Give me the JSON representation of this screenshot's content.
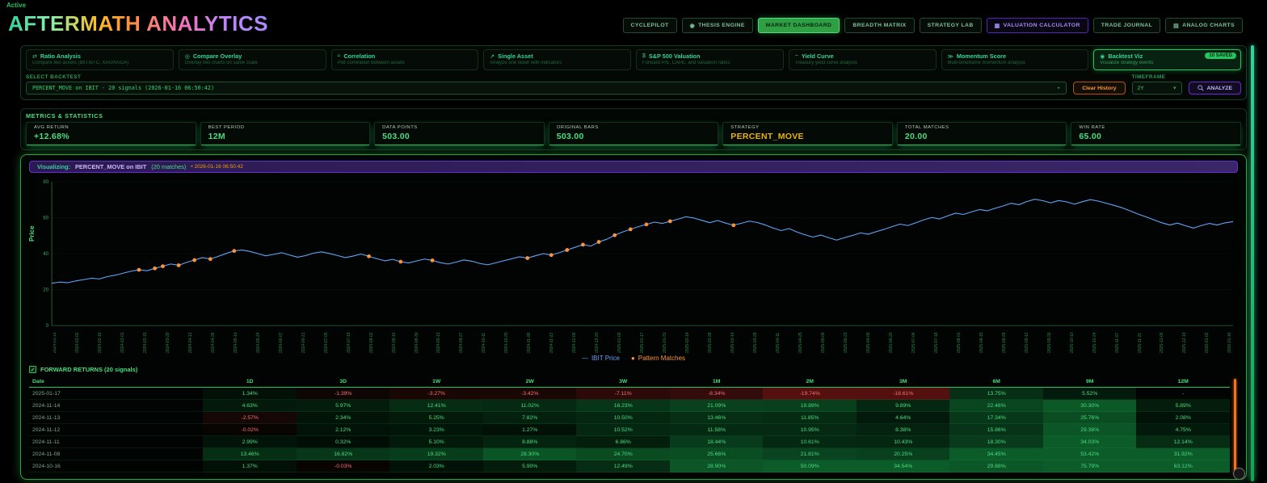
{
  "app": {
    "status": "Active",
    "title": "AFTERMATH ANALYTICS"
  },
  "nav": {
    "items": [
      {
        "label": "CYCLEPILOT"
      },
      {
        "label": "THESIS ENGINE",
        "icon": "◉",
        "icon_name": "thesis-engine-icon"
      },
      {
        "label": "MARKET DASHBOARD",
        "active": true
      },
      {
        "label": "BREADTH MATRIX"
      },
      {
        "label": "STRATEGY LAB"
      },
      {
        "label": "VALUATION CALCULATOR",
        "icon": "▦",
        "icon_name": "calculator-icon",
        "variant": "purple"
      },
      {
        "label": "TRADE JOURNAL"
      },
      {
        "label": "ANALOG CHARTS",
        "icon": "▤",
        "icon_name": "analog-charts-icon"
      }
    ]
  },
  "tools": {
    "cards": [
      {
        "icon": "⇄",
        "icon_name": "ratio-icon",
        "title": "Ratio Analysis",
        "subtitle": "Compare two assets (IBIT/BTC, XAU/NVDA)"
      },
      {
        "icon": "◎",
        "icon_name": "overlay-icon",
        "title": "Compare Overlay",
        "subtitle": "Overlay two charts on same scale"
      },
      {
        "icon": "≈",
        "icon_name": "correlation-icon",
        "title": "Correlation",
        "subtitle": "Plot correlation between assets"
      },
      {
        "icon": "↗",
        "icon_name": "trend-icon",
        "title": "Single Asset",
        "subtitle": "Analyze one ticker with indicators"
      },
      {
        "icon": "$",
        "icon_name": "dollar-icon",
        "title": "S&P 500 Valuation",
        "subtitle": "Forward P/E, CAPE, and valuation ratios"
      },
      {
        "icon": "~",
        "icon_name": "yield-curve-icon",
        "title": "Yield Curve",
        "subtitle": "Treasury yield curve analysis"
      },
      {
        "icon": "≫",
        "icon_name": "momentum-icon",
        "title": "Momentum Score",
        "subtitle": "Multi-timeframe momentum analysis"
      },
      {
        "icon": "◉",
        "icon_name": "backtest-icon",
        "title": "Backtest Viz",
        "subtitle": "Visualize strategy events",
        "selected": true,
        "badge": "10 SAVED"
      }
    ]
  },
  "backtest": {
    "label": "SELECT BACKTEST",
    "value": "PERCENT_MOVE on IBIT - 20 signals (2026-01-16 06:50:42)",
    "clear_label": "Clear History",
    "timeframe_label": "TIMEFRAME",
    "timeframe_value": "2Y",
    "analyze_label": "ANALYZE"
  },
  "metrics": {
    "heading": "METRICS & STATISTICS",
    "cards": [
      {
        "label": "AVG RETURN",
        "value": "+12.68%",
        "color": "#4ade80"
      },
      {
        "label": "BEST PERIOD",
        "value": "12M",
        "color": "#4ade80"
      },
      {
        "label": "DATA POINTS",
        "value": "503.00",
        "color": "#4ade80"
      },
      {
        "label": "ORIGINAL BARS",
        "value": "503.00",
        "color": "#4ade80"
      },
      {
        "label": "STRATEGY",
        "value": "PERCENT_MOVE",
        "color": "#eab308"
      },
      {
        "label": "TOTAL MATCHES",
        "value": "20.00",
        "color": "#4ade80"
      },
      {
        "label": "WIN RATE",
        "value": "65.00",
        "color": "#4ade80"
      }
    ]
  },
  "viz": {
    "prefix": "Visualizing:",
    "name": "PERCENT_MOVE on IBIT",
    "matches": "(20 matches)",
    "timestamp": "• 2026-01-16 06:50:42"
  },
  "chart_data": {
    "type": "line",
    "title": "",
    "xlabel": "",
    "ylabel": "Price",
    "ylim": [
      0,
      80
    ],
    "yticks": [
      0,
      20,
      40,
      60,
      80
    ],
    "grid": true,
    "legend_position": "bottom",
    "legend": [
      "IBIT Price",
      "Pattern Matches"
    ],
    "x_labels": [
      "2024-01-19",
      "2024-02-02",
      "2024-02-16",
      "2024-03-01",
      "2024-03-15",
      "2024-03-29",
      "2024-04-12",
      "2024-04-26",
      "2024-05-10",
      "2024-05-24",
      "2024-06-07",
      "2024-06-21",
      "2024-07-05",
      "2024-07-19",
      "2024-08-02",
      "2024-08-16",
      "2024-08-30",
      "2024-09-13",
      "2024-09-27",
      "2024-10-11",
      "2024-10-25",
      "2024-11-08",
      "2024-11-22",
      "2024-12-06",
      "2024-12-20",
      "2025-01-03",
      "2025-01-17",
      "2025-01-31",
      "2025-02-14",
      "2025-02-28",
      "2025-03-14",
      "2025-03-28",
      "2025-04-11",
      "2025-04-25",
      "2025-05-09",
      "2025-05-23",
      "2025-06-06",
      "2025-06-20",
      "2025-07-04",
      "2025-07-18",
      "2025-08-01",
      "2025-08-15",
      "2025-08-29",
      "2025-09-12",
      "2025-09-26",
      "2025-10-10",
      "2025-10-24",
      "2025-11-07",
      "2025-11-21",
      "2025-12-05",
      "2025-12-19",
      "2026-01-02",
      "2026-01-16"
    ],
    "series": [
      {
        "name": "IBIT Price",
        "color": "#60a5fa",
        "values": [
          23.5,
          24.2,
          23.8,
          24.8,
          25.5,
          26.3,
          25.9,
          27.2,
          28.0,
          29.1,
          30.2,
          31.0,
          30.5,
          31.8,
          33.0,
          34.2,
          33.5,
          35.1,
          36.4,
          37.8,
          37.0,
          38.5,
          40.1,
          41.5,
          42.0,
          41.2,
          40.0,
          38.8,
          39.6,
          40.5,
          39.2,
          38.0,
          38.9,
          40.2,
          41.0,
          40.1,
          39.0,
          37.8,
          38.6,
          39.8,
          38.5,
          37.2,
          36.0,
          36.8,
          35.5,
          34.8,
          35.9,
          37.0,
          36.2,
          35.0,
          34.2,
          35.3,
          36.5,
          35.8,
          34.5,
          33.8,
          34.9,
          36.0,
          37.1,
          38.2,
          37.5,
          38.8,
          40.0,
          39.2,
          40.5,
          42.0,
          43.5,
          45.0,
          44.2,
          46.5,
          48.0,
          50.2,
          52.0,
          53.5,
          55.0,
          56.2,
          57.5,
          56.8,
          58.0,
          59.2,
          60.5,
          59.8,
          58.5,
          57.2,
          58.4,
          57.0,
          55.8,
          56.9,
          58.1,
          57.3,
          55.9,
          54.2,
          52.8,
          53.9,
          52.0,
          50.5,
          49.2,
          50.3,
          48.8,
          47.5,
          48.9,
          50.1,
          51.5,
          50.8,
          52.2,
          53.5,
          55.0,
          56.4,
          55.6,
          57.2,
          58.8,
          60.1,
          59.3,
          61.0,
          62.5,
          61.8,
          63.2,
          64.5,
          63.8,
          65.2,
          66.5,
          68.0,
          67.2,
          69.0,
          70.2,
          69.4,
          68.2,
          69.5,
          68.8,
          67.5,
          68.9,
          70.0,
          69.2,
          68.0,
          66.8,
          65.5,
          63.8,
          62.0,
          60.5,
          58.8,
          57.2,
          55.9,
          57.0,
          55.5,
          54.2,
          55.6,
          56.8,
          55.9,
          57.1,
          57.8
        ]
      }
    ],
    "markers": {
      "name": "Pattern Matches",
      "color": "#fb923c",
      "indices": [
        11,
        13,
        14,
        16,
        18,
        20,
        23,
        40,
        44,
        48,
        60,
        63,
        65,
        67,
        69,
        71,
        73,
        75,
        78,
        86
      ]
    }
  },
  "table": {
    "title": "FORWARD RETURNS (20 signals)",
    "columns": [
      "Date",
      "1D",
      "3D",
      "1W",
      "2W",
      "3W",
      "1M",
      "2M",
      "3M",
      "6M",
      "9M",
      "12M"
    ],
    "rows": [
      [
        "2025-01-17",
        "1.34%",
        "-1.39%",
        "-3.27%",
        "-3.42%",
        "-7.11%",
        "-8.34%",
        "-19.74%",
        "-18.61%",
        "13.75%",
        "5.52%",
        "-"
      ],
      [
        "2024-11-14",
        "4.63%",
        "5.97%",
        "12.41%",
        "11.02%",
        "16.23%",
        "21.09%",
        "19.89%",
        "9.89%",
        "22.46%",
        "30.30%",
        "5.89%"
      ],
      [
        "2024-11-13",
        "-2.57%",
        "2.34%",
        "5.25%",
        "7.82%",
        "10.50%",
        "13.46%",
        "11.85%",
        "4.64%",
        "17.34%",
        "25.76%",
        "2.08%"
      ],
      [
        "2024-11-12",
        "-0.02%",
        "2.12%",
        "3.23%",
        "1.27%",
        "10.52%",
        "11.58%",
        "10.95%",
        "8.38%",
        "15.86%",
        "29.38%",
        "4.75%"
      ],
      [
        "2024-11-11",
        "2.99%",
        "0.32%",
        "5.10%",
        "8.88%",
        "6.86%",
        "18.44%",
        "10.61%",
        "10.43%",
        "18.30%",
        "34.03%",
        "12.14%"
      ],
      [
        "2024-11-08",
        "13.46%",
        "16.82%",
        "19.32%",
        "28.30%",
        "24.70%",
        "25.66%",
        "21.81%",
        "20.25%",
        "34.45%",
        "53.42%",
        "31.92%"
      ],
      [
        "2024-10-16",
        "1.37%",
        "-0.03%",
        "2.03%",
        "5.90%",
        "12.49%",
        "28.90%",
        "50.09%",
        "34.54%",
        "29.88%",
        "75.79%",
        "63.12%"
      ]
    ]
  }
}
